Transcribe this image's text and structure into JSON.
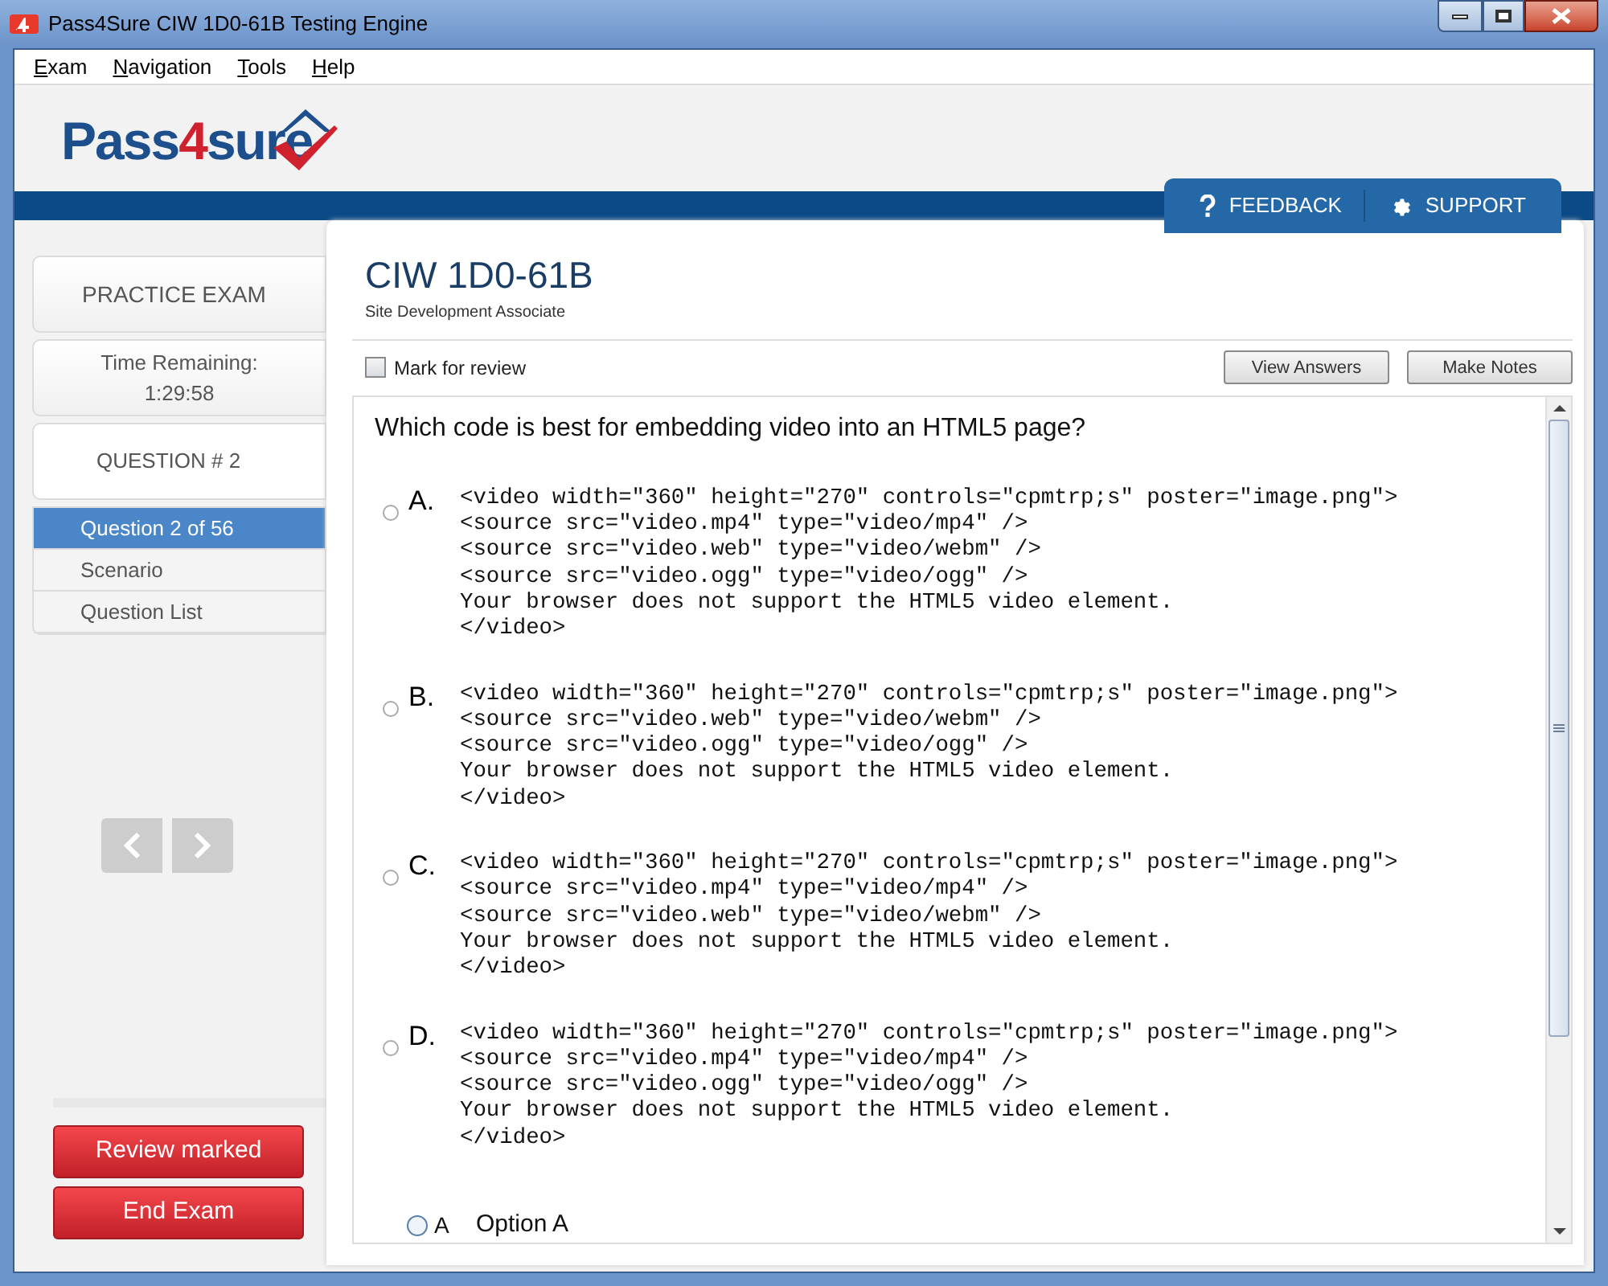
{
  "window": {
    "title": "Pass4Sure CIW 1D0-61B Testing Engine"
  },
  "menu": [
    "Exam",
    "Navigation",
    "Tools",
    "Help"
  ],
  "logo": {
    "before": "Pass",
    "highlight": "4",
    "after": "sure"
  },
  "header_tabs": [
    {
      "label": "FEEDBACK"
    },
    {
      "label": "SUPPORT"
    }
  ],
  "sidebar": {
    "practice_label": "PRACTICE EXAM",
    "time_label": "Time Remaining:",
    "time": "1:29:58",
    "question_label": "QUESTION # 2",
    "nav_items": [
      {
        "label": "Question 2 of 56",
        "selected": true
      },
      {
        "label": "Scenario",
        "selected": false
      },
      {
        "label": "Question List",
        "selected": false
      }
    ],
    "buttons": [
      "Review marked",
      "End Exam"
    ]
  },
  "exam": {
    "title": "CIW 1D0-61B",
    "subtitle": "Site Development Associate",
    "mark_for_review": {
      "label": "Mark for review",
      "checked": false
    },
    "buttons": [
      "View Answers",
      "Make Notes"
    ],
    "question": "Which code is best for embedding video into an HTML5 page?",
    "options": [
      {
        "letter": "A.",
        "selected": false,
        "code": [
          "<video width=\"360\" height=\"270\" controls=\"cpmtrp;s\" poster=\"image.png\">",
          "<source src=\"video.mp4\" type=\"video/mp4\" />",
          "<source src=\"video.web\" type=\"video/webm\" />",
          "<source src=\"video.ogg\" type=\"video/ogg\" />",
          "Your browser does not support the HTML5 video element.",
          "</video>"
        ]
      },
      {
        "letter": "B.",
        "selected": false,
        "code": [
          "<video width=\"360\" height=\"270\" controls=\"cpmtrp;s\" poster=\"image.png\">",
          "<source src=\"video.web\" type=\"video/webm\" />",
          "<source src=\"video.ogg\" type=\"video/ogg\" />",
          "Your browser does not support the HTML5 video element.",
          "</video>"
        ]
      },
      {
        "letter": "C.",
        "selected": false,
        "code": [
          "<video width=\"360\" height=\"270\" controls=\"cpmtrp;s\" poster=\"image.png\">",
          "<source src=\"video.mp4\" type=\"video/mp4\" />",
          "<source src=\"video.web\" type=\"video/webm\" />",
          "Your browser does not support the HTML5 video element.",
          "</video>"
        ]
      },
      {
        "letter": "D.",
        "selected": false,
        "code": [
          "<video width=\"360\" height=\"270\" controls=\"cpmtrp;s\" poster=\"image.png\">",
          "<source src=\"video.mp4\" type=\"video/mp4\" />",
          "<source src=\"video.ogg\" type=\"video/ogg\" />",
          "Your browser does not support the HTML5 video element.",
          "</video>"
        ]
      }
    ],
    "answer_choices": [
      {
        "letter": "A",
        "label": "Option A",
        "selected": false
      }
    ]
  }
}
